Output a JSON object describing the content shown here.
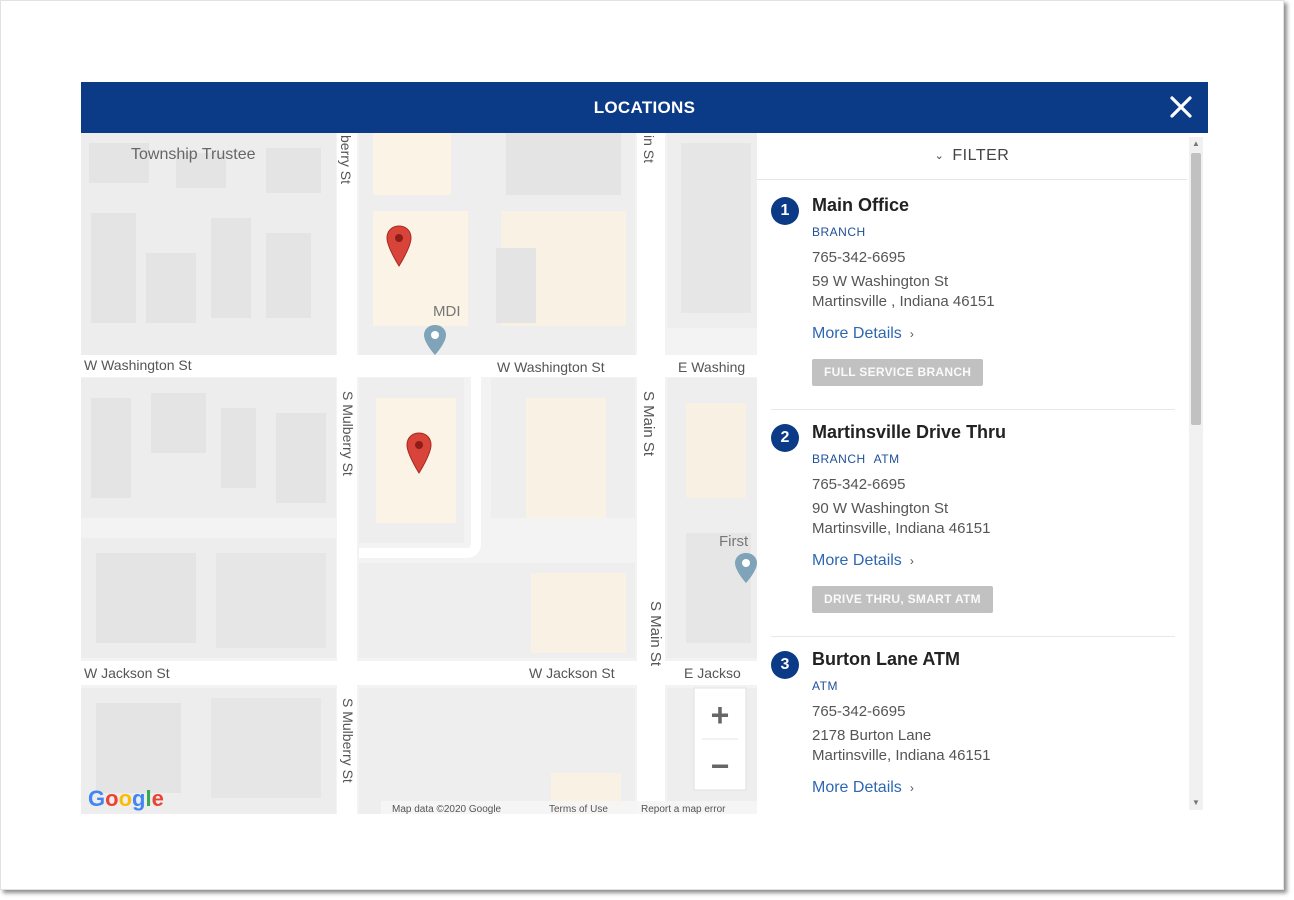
{
  "header": {
    "title": "LOCATIONS"
  },
  "colors": {
    "header_bg": "#0b3a86",
    "marker": "#d9443a",
    "link": "#2e67b1"
  },
  "filter": {
    "label": "FILTER"
  },
  "map": {
    "labels": {
      "township": "Township Trustee",
      "mdi": "MDI",
      "first": "First",
      "w_washington_left": "W Washington St",
      "w_washington_mid": "W Washington St",
      "e_washington": "E Washing",
      "w_jackson_left": "W Jackson St",
      "w_jackson_mid": "W Jackson St",
      "e_jackson": "E Jackso",
      "mulberry_top": "berry St",
      "mulberry_mid": "S Mulberry St",
      "mulberry_bottom": "S Mulberry St",
      "main_top": "in St",
      "main_mid": "S Main St",
      "main_bottom": "S Main St"
    },
    "zoom_in": "+",
    "zoom_out": "−",
    "footer": {
      "mapdata": "Map data ©2020 Google",
      "terms": "Terms of Use",
      "report": "Report a map error"
    },
    "google_letters": [
      "G",
      "o",
      "o",
      "g",
      "l",
      "e"
    ]
  },
  "locations": [
    {
      "number": "1",
      "name": "Main Office",
      "types": [
        "BRANCH"
      ],
      "phone": "765-342-6695",
      "address_line1": "59 W Washington St",
      "address_line2": "Martinsville , Indiana 46151",
      "more_details": "More Details",
      "services": "FULL SERVICE BRANCH"
    },
    {
      "number": "2",
      "name": "Martinsville Drive Thru",
      "types": [
        "BRANCH",
        "ATM"
      ],
      "phone": "765-342-6695",
      "address_line1": "90 W Washington St",
      "address_line2": "Martinsville, Indiana 46151",
      "more_details": "More Details",
      "services": "DRIVE THRU, SMART ATM"
    },
    {
      "number": "3",
      "name": "Burton Lane ATM",
      "types": [
        "ATM"
      ],
      "phone": "765-342-6695",
      "address_line1": "2178 Burton Lane",
      "address_line2": "Martinsville, Indiana 46151",
      "more_details": "More Details"
    }
  ]
}
